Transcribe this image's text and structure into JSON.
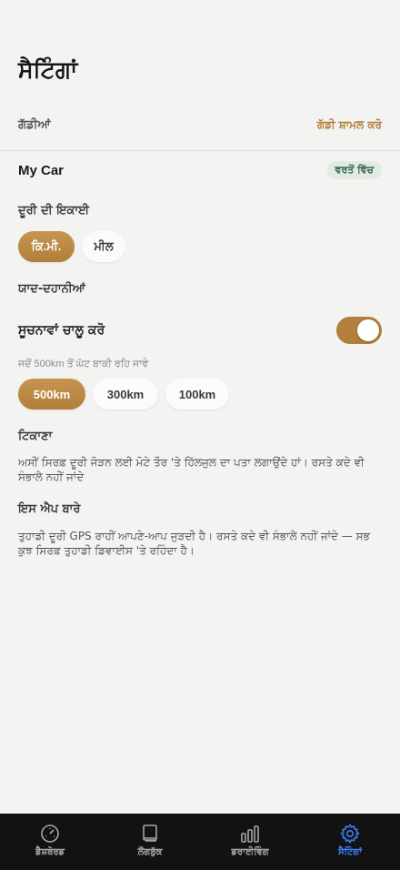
{
  "page": {
    "title": "ਸੈਟਿੰਗਾਂ"
  },
  "vehicles": {
    "heading": "ਗੱਡੀਆਂ",
    "add_label": "ਗੱਡੀ ਸ਼ਾਮਲ ਕਰੋ",
    "items": [
      {
        "name": "My Car",
        "badge": "ਵਰਤੋਂ ਵਿੱਚ"
      }
    ]
  },
  "distance_unit": {
    "heading": "ਦੂਰੀ ਦੀ ਇਕਾਈ",
    "options": [
      "ਕਿ.ਮੀ.",
      "ਮੀਲ"
    ],
    "selected": "ਕਿ.ਮੀ."
  },
  "reminders": {
    "heading": "ਯਾਦ-ਦਹਾਨੀਆਂ",
    "toggle_label": "ਸੂਚਨਾਵਾਂ ਚਾਲੂ ਕਰੋ",
    "toggle_on": true,
    "threshold_hint": "ਜਦੋਂ 500km ਤੋਂ ਘੱਟ ਬਾਕੀ ਰਹਿ ਜਾਵੇ",
    "threshold_options": [
      "500km",
      "300km",
      "100km"
    ],
    "threshold_selected": "500km"
  },
  "location": {
    "heading": "ਟਿਕਾਣਾ",
    "text": "ਅਸੀਂ ਸਿਰਫ਼ ਦੂਰੀ ਜੋੜਨ ਲਈ ਮੋਟੇ ਤੌਰ 'ਤੇ ਹਿੱਲਜੁਲ ਦਾ ਪਤਾ ਲਗਾਉਂਦੇ ਹਾਂ। ਰਸਤੇ ਕਦੇ ਵੀ ਸੰਭਾਲੇ ਨਹੀਂ ਜਾਂਦੇ"
  },
  "about": {
    "heading": "ਇਸ ਐਪ ਬਾਰੇ",
    "text": "ਤੁਹਾਡੀ ਦੂਰੀ GPS ਰਾਹੀਂ ਆਪਣੇ-ਆਪ ਜੁੜਦੀ ਹੈ। ਰਸਤੇ ਕਦੇ ਵੀ ਸੰਭਾਲੇ ਨਹੀਂ ਜਾਂਦੇ — ਸਭ ਕੁਝ ਸਿਰਫ਼ ਤੁਹਾਡੀ ਡਿਵਾਈਸ 'ਤੇ ਰਹਿੰਦਾ ਹੈ।"
  },
  "tab_bar": {
    "tabs": [
      {
        "label": "ਡੈਸ਼ਬੋਰਡ",
        "icon": "speedometer-icon"
      },
      {
        "label": "ਲੌਗਬੁੱਕ",
        "icon": "book-icon"
      },
      {
        "label": "ਡਰਾਈਵਿੰਗ",
        "icon": "bar-chart-icon"
      },
      {
        "label": "ਸੈਟਿੰਗਾਂ",
        "icon": "gear-icon"
      }
    ],
    "active": "ਸੈਟਿੰਗਾਂ"
  },
  "colors": {
    "accent_gold": "#b27f3a",
    "badge_green": "#3e6b57",
    "tab_active_blue": "#3d7cf0",
    "tab_bar_bg": "#121212"
  }
}
